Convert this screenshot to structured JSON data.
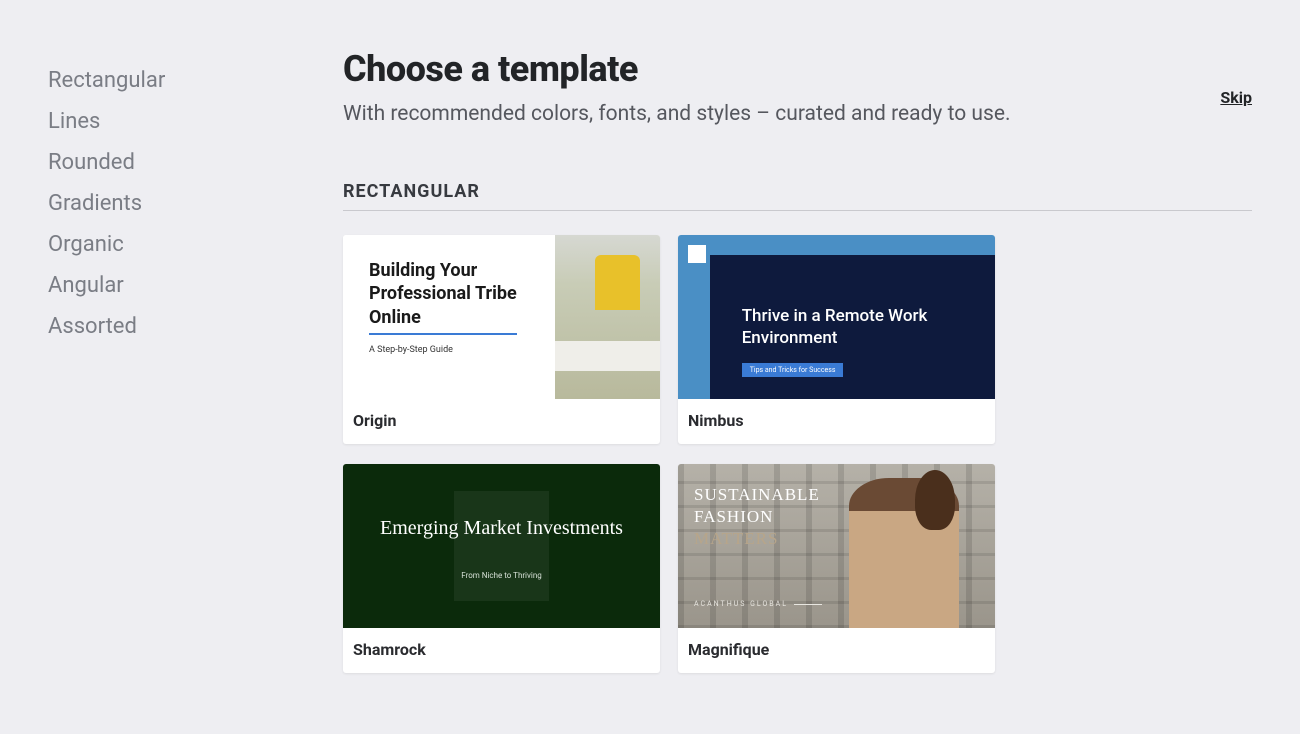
{
  "sidebar": {
    "items": [
      {
        "label": "Rectangular"
      },
      {
        "label": "Lines"
      },
      {
        "label": "Rounded"
      },
      {
        "label": "Gradients"
      },
      {
        "label": "Organic"
      },
      {
        "label": "Angular"
      },
      {
        "label": "Assorted"
      }
    ]
  },
  "header": {
    "title": "Choose a template",
    "subtitle": "With recommended colors, fonts, and styles – curated and ready to use.",
    "skip": "Skip"
  },
  "section": {
    "heading": "RECTANGULAR"
  },
  "templates": {
    "origin": {
      "name": "Origin",
      "preview_title": "Building Your Professional Tribe Online",
      "preview_sub": "A Step-by-Step Guide"
    },
    "nimbus": {
      "name": "Nimbus",
      "preview_title": "Thrive in a Remote Work Environment",
      "preview_tag": "Tips and Tricks for Success"
    },
    "shamrock": {
      "name": "Shamrock",
      "preview_title": "Emerging Market Investments",
      "preview_sub": "From Niche to Thriving"
    },
    "magnifique": {
      "name": "Magnifique",
      "preview_line1": "SUSTAINABLE",
      "preview_line2": "FASHION",
      "preview_line3": "MATTERS",
      "preview_brand": "ACANTHUS GLOBAL"
    }
  }
}
